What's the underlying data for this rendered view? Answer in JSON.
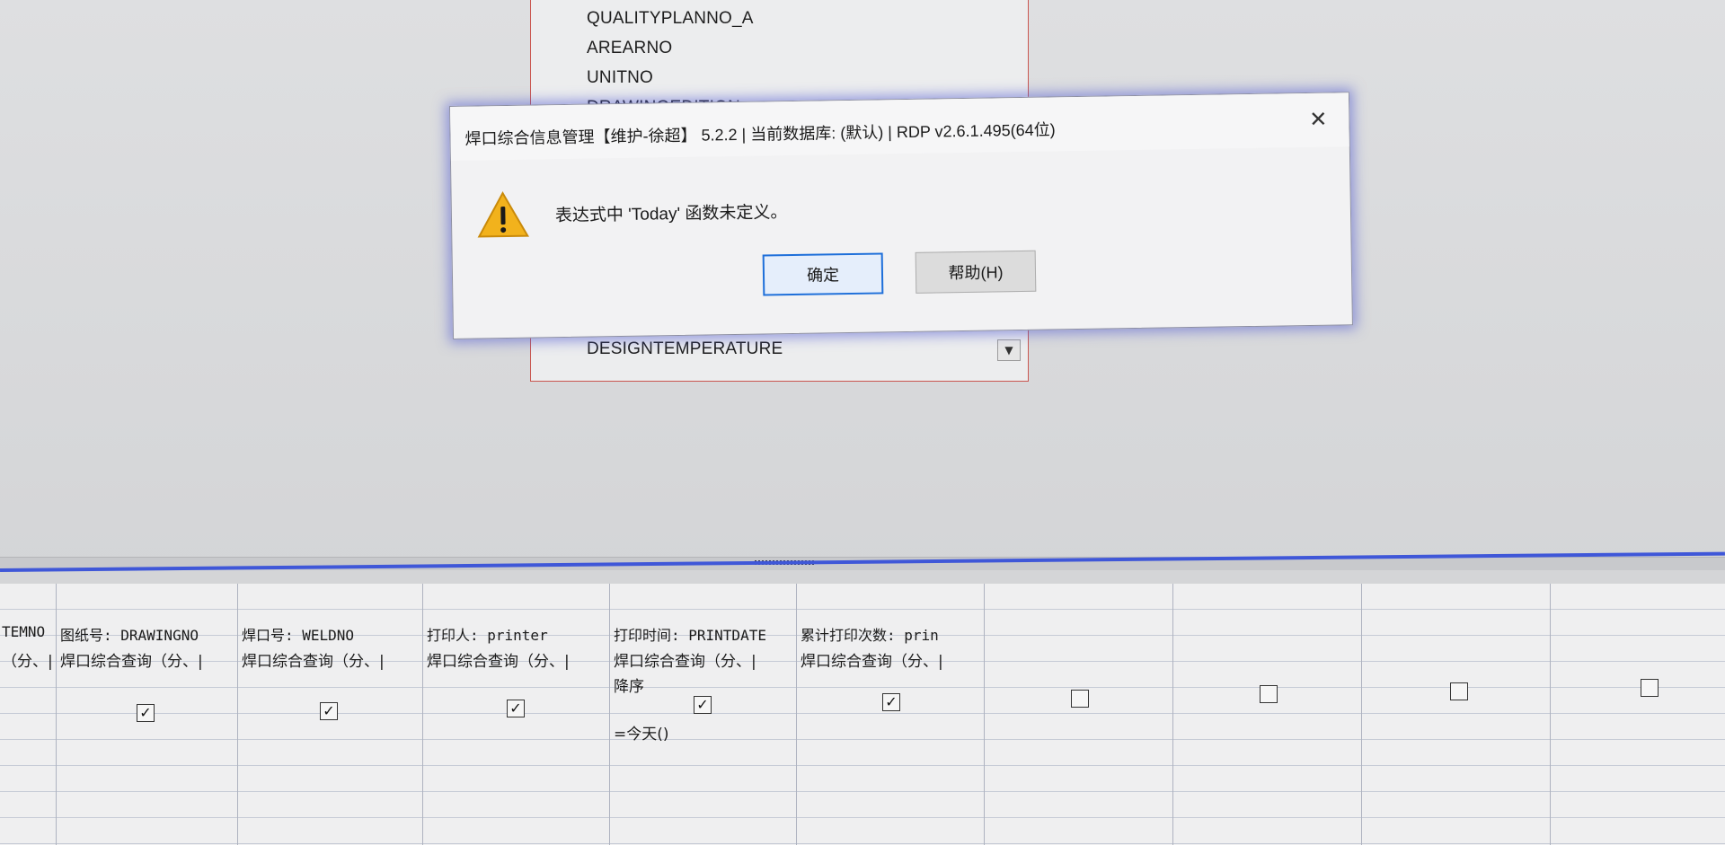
{
  "field_list": {
    "items": [
      "QUALITYPLANNO_A",
      "AREARNO",
      "UNITNO",
      "DRAWINGEDITION"
    ],
    "selected": "DESIGNTEMPERATURE"
  },
  "dialog": {
    "title": "焊口综合信息管理【维护-徐超】 5.2.2 | 当前数据库: (默认) | RDP v2.6.1.495(64位)",
    "message": "表达式中 'Today' 函数未定义。",
    "ok_label": "确定",
    "help_label": "帮助(H)",
    "close_glyph": "✕"
  },
  "grid": {
    "columns": [
      {
        "field": "TEMNO",
        "source": "（分、|",
        "checked": null
      },
      {
        "field": "图纸号: DRAWINGNO",
        "source": "焊口综合查询（分、|",
        "checked": true
      },
      {
        "field": "焊口号: WELDNO",
        "source": "焊口综合查询（分、|",
        "checked": true
      },
      {
        "field": "打印人: printer",
        "source": "焊口综合查询（分、|",
        "checked": true
      },
      {
        "field": "打印时间: PRINTDATE",
        "source": "焊口综合查询（分、|",
        "checked": true,
        "sort": "降序",
        "expr": "=今天()"
      },
      {
        "field": "累计打印次数: prin",
        "source": "焊口综合查询（分、|",
        "checked": true
      },
      {
        "field": "",
        "source": "",
        "checked": false
      },
      {
        "field": "",
        "source": "",
        "checked": false
      },
      {
        "field": "",
        "source": "",
        "checked": false
      },
      {
        "field": "",
        "source": "",
        "checked": false
      }
    ]
  }
}
